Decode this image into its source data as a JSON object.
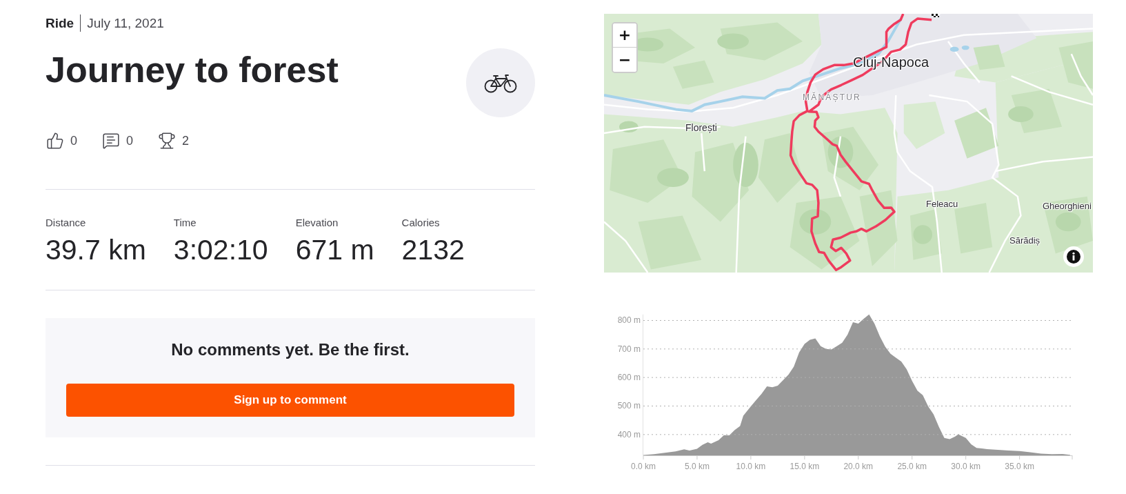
{
  "activity": {
    "type": "Ride",
    "date": "July 11, 2021",
    "title": "Journey to forest"
  },
  "reactions": [
    {
      "kind": "kudos",
      "count": "0"
    },
    {
      "kind": "comments",
      "count": "0"
    },
    {
      "kind": "achievements",
      "count": "2"
    }
  ],
  "stats": [
    {
      "label": "Distance",
      "value": "39.7 km"
    },
    {
      "label": "Time",
      "value": "3:02:10"
    },
    {
      "label": "Elevation",
      "value": "671 m"
    },
    {
      "label": "Calories",
      "value": "2132"
    }
  ],
  "comments": {
    "empty_message": "No comments yet. Be the first.",
    "button": "Sign up to comment"
  },
  "map": {
    "zoom_in": "+",
    "zoom_out": "−",
    "place_labels": [
      {
        "text": "Cluj-Napoca",
        "kind": "city"
      },
      {
        "text": "MĂNĂȘTUR",
        "kind": "district"
      },
      {
        "text": "Florești",
        "kind": "town"
      },
      {
        "text": "Feleacu",
        "kind": "village"
      },
      {
        "text": "Gheorghieni",
        "kind": "village"
      },
      {
        "text": "Sărădiș",
        "kind": "village"
      }
    ]
  },
  "elevation_profile": {
    "chart_data": {
      "type": "area",
      "x": [
        0,
        1,
        2,
        3,
        3.8,
        4.3,
        5,
        5.5,
        6,
        6.3,
        7,
        7.5,
        8,
        8.5,
        9,
        9.3,
        10,
        10.5,
        11,
        11.5,
        12,
        12.5,
        13,
        13.5,
        14,
        14.5,
        15,
        15.5,
        16,
        16.5,
        17,
        17.5,
        18,
        18.5,
        19,
        19.5,
        20,
        20.5,
        21,
        21.5,
        22,
        22.5,
        23,
        23.5,
        24,
        24.5,
        25,
        25.5,
        26,
        26.5,
        27,
        27.5,
        28,
        28.5,
        29,
        29.3,
        30,
        30.5,
        31,
        31.5,
        32,
        33,
        34,
        35,
        36,
        37,
        38,
        39,
        39.7
      ],
      "series": [
        {
          "color": "#999999",
          "values": [
            328,
            331,
            336,
            341,
            348,
            344,
            350,
            364,
            373,
            368,
            380,
            398,
            397,
            416,
            430,
            466,
            499,
            521,
            543,
            569,
            566,
            571,
            591,
            610,
            638,
            688,
            718,
            732,
            737,
            710,
            700,
            698,
            710,
            722,
            750,
            794,
            789,
            806,
            821,
            789,
            744,
            708,
            683,
            669,
            656,
            629,
            588,
            554,
            538,
            499,
            471,
            427,
            388,
            384,
            393,
            401,
            388,
            366,
            353,
            351,
            349,
            346,
            344,
            342,
            338,
            333,
            331,
            332,
            329
          ]
        }
      ],
      "xlim": [
        0,
        39.9
      ],
      "ylim": [
        327,
        821
      ],
      "xticks": [
        {
          "value": 0,
          "label": "0.0 km"
        },
        {
          "value": 5,
          "label": "5.0 km"
        },
        {
          "value": 10,
          "label": "10.0 km"
        },
        {
          "value": 15,
          "label": "15.0 km"
        },
        {
          "value": 20,
          "label": "20.0 km"
        },
        {
          "value": 25,
          "label": "25.0 km"
        },
        {
          "value": 30,
          "label": "30.0 km"
        },
        {
          "value": 35,
          "label": "35.0 km"
        }
      ],
      "yticks": [
        {
          "value": 400,
          "label": "400 m"
        },
        {
          "value": 500,
          "label": "500 m"
        },
        {
          "value": 600,
          "label": "600 m"
        },
        {
          "value": 700,
          "label": "700 m"
        },
        {
          "value": 800,
          "label": "800 m"
        }
      ],
      "grid": true
    }
  }
}
